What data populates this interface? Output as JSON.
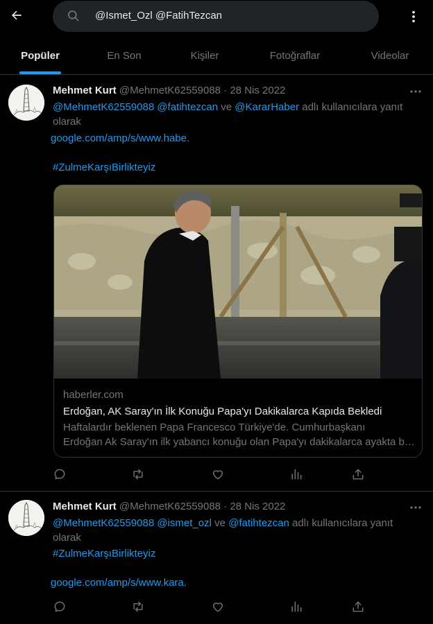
{
  "search": {
    "query": "@Ismet_Ozl @FatihTezcan",
    "icon": "search-icon"
  },
  "tabs": [
    {
      "label": "Popüler"
    },
    {
      "label": "En Son"
    },
    {
      "label": "Kişiler"
    },
    {
      "label": "Fotoğraflar"
    },
    {
      "label": "Videolar"
    }
  ],
  "tweets": [
    {
      "name": "Mehmet Kurt",
      "handle": "@MehmetK62559088",
      "sep": "·",
      "date": "28 Nis 2022",
      "reply_mentions": "@MehmetK62559088 @fatihtezcan",
      "reply_and": "ve",
      "reply_last": "@KararHaber",
      "reply_suffix": "adlı kullanıcılara yanıt",
      "reply_line2": "olarak",
      "link": "google.com/amp/s/www.habe.",
      "hashtag": "#ZulmeKarşıBirlikteyiz",
      "card": {
        "domain": "haberler.com",
        "title": "Erdoğan, AK Saray'ın İlk Konuğu Papa'yı Dakikalarca Kapıda Bekledi",
        "desc_line1": "Haftalardır beklenen Papa Francesco Türkiye'de. Cumhurbaşkanı",
        "desc_line2": "Erdoğan Ak Saray'ın ilk yabancı konuğu olan Papa'yı dakikalarca ayakta bekledi."
      }
    },
    {
      "name": "Mehmet Kurt",
      "handle": "@MehmetK62559088",
      "sep": "·",
      "date": "28 Nis 2022",
      "reply_mentions": "@MehmetK62559088 @ismet_ozl",
      "reply_and": "ve",
      "reply_last": "@fatihtezcan",
      "reply_suffix": "adlı kullanıcılara yanıt",
      "reply_line2": "olarak",
      "hashtag": "#ZulmeKarşıBirlikteyiz",
      "link": "google.com/amp/s/www.kara."
    }
  ],
  "colors": {
    "accent": "#1d9bf0",
    "background": "#000000",
    "muted": "#71767b",
    "text": "#e7e9ea",
    "border": "#2f3336"
  }
}
